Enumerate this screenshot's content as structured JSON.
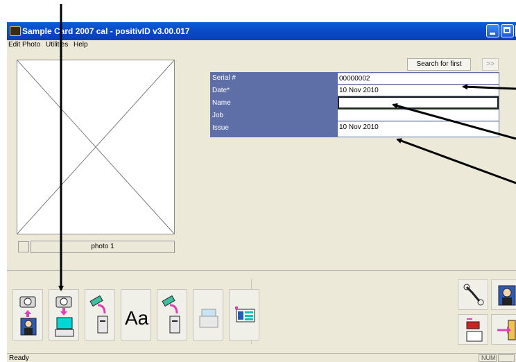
{
  "window": {
    "title": "Sample Card 2007 cal - positivID v3.00.017"
  },
  "menu": [
    "Edit",
    "Photo",
    "Utilities",
    "Help"
  ],
  "photo": {
    "label": "photo 1"
  },
  "search": {
    "button_label": "Search for first",
    "next_label": ">>"
  },
  "record": {
    "fields": [
      {
        "label": "Serial #",
        "value": "00000002"
      },
      {
        "label": "Date*",
        "value": "10 Nov 2010"
      },
      {
        "label": "Name",
        "value": ""
      },
      {
        "label": "Job",
        "value": ""
      },
      {
        "label": "Issue",
        "value": "10 Nov 2010"
      }
    ]
  },
  "toolbar": {
    "buttons": [
      {
        "name": "capture-to-photo",
        "icon": "camera-to-person-icon"
      },
      {
        "name": "capture-to-computer",
        "icon": "camera-to-computer-icon"
      },
      {
        "name": "print-card-front",
        "icon": "card-printer-icon"
      },
      {
        "name": "text-font",
        "icon": "font-icon",
        "text": "Aa"
      },
      {
        "name": "print-card-back",
        "icon": "card-printer-icon"
      },
      {
        "name": "printer",
        "icon": "printer-icon"
      },
      {
        "name": "card-layout",
        "icon": "card-layout-icon"
      }
    ],
    "right_buttons": [
      {
        "name": "settings",
        "icon": "wrench-icon"
      },
      {
        "name": "user",
        "icon": "person-icon"
      },
      {
        "name": "import",
        "icon": "import-icon"
      },
      {
        "name": "exit",
        "icon": "exit-door-icon"
      }
    ]
  },
  "status": {
    "text": "Ready",
    "num_label": "NUM"
  },
  "colors": {
    "titlebar": "#0a5ed8",
    "grid_label_bg": "#5e6fa8",
    "window_bg": "#ece9d8"
  }
}
